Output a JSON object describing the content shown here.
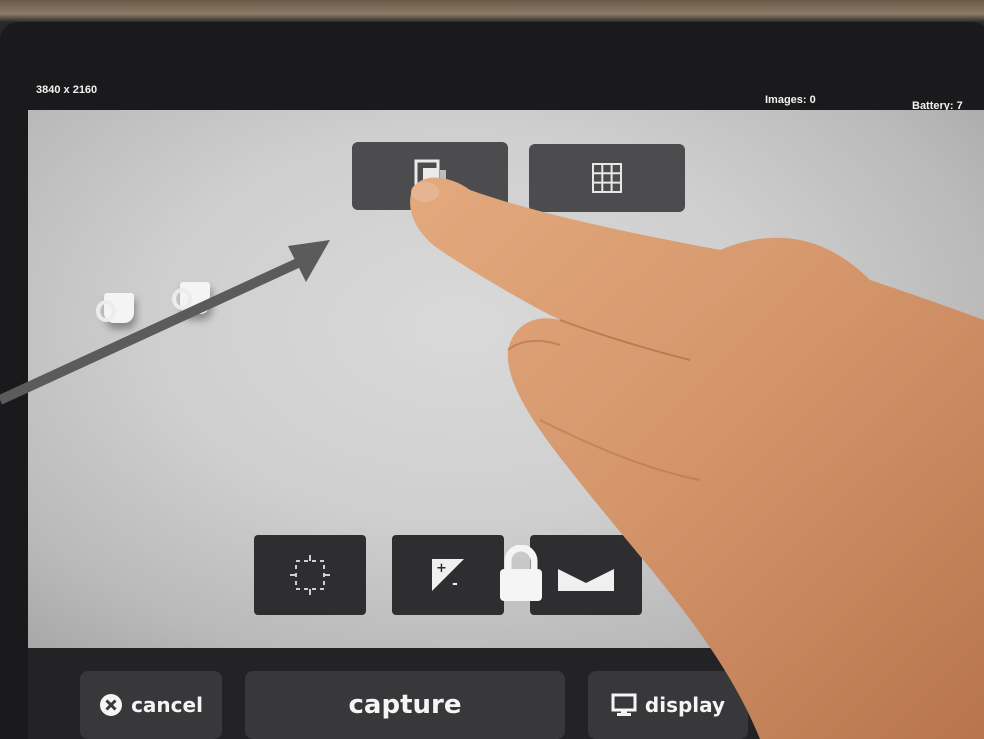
{
  "status_bar": {
    "resolution": "3840 x 2160",
    "images": "Images: 0",
    "battery": "Battery: 7"
  },
  "mode_buttons": [
    {
      "name": "single-frame",
      "icon": "single-frame-icon"
    },
    {
      "name": "grid",
      "icon": "grid-icon"
    }
  ],
  "toolbar": [
    {
      "icon": "focus-target-icon"
    },
    {
      "icon": "exposure-icon"
    },
    {
      "icon": "white-balance-icon"
    }
  ],
  "lock_icon": "lock-icon",
  "bottom_bar": {
    "cancel_label": "cancel",
    "capture_label": "capture",
    "display_label": "display"
  },
  "colors": {
    "arrow": "#5b5b5b",
    "skin": "#d99a6c",
    "screen": "#cfcfcf",
    "bar": "#232325"
  }
}
